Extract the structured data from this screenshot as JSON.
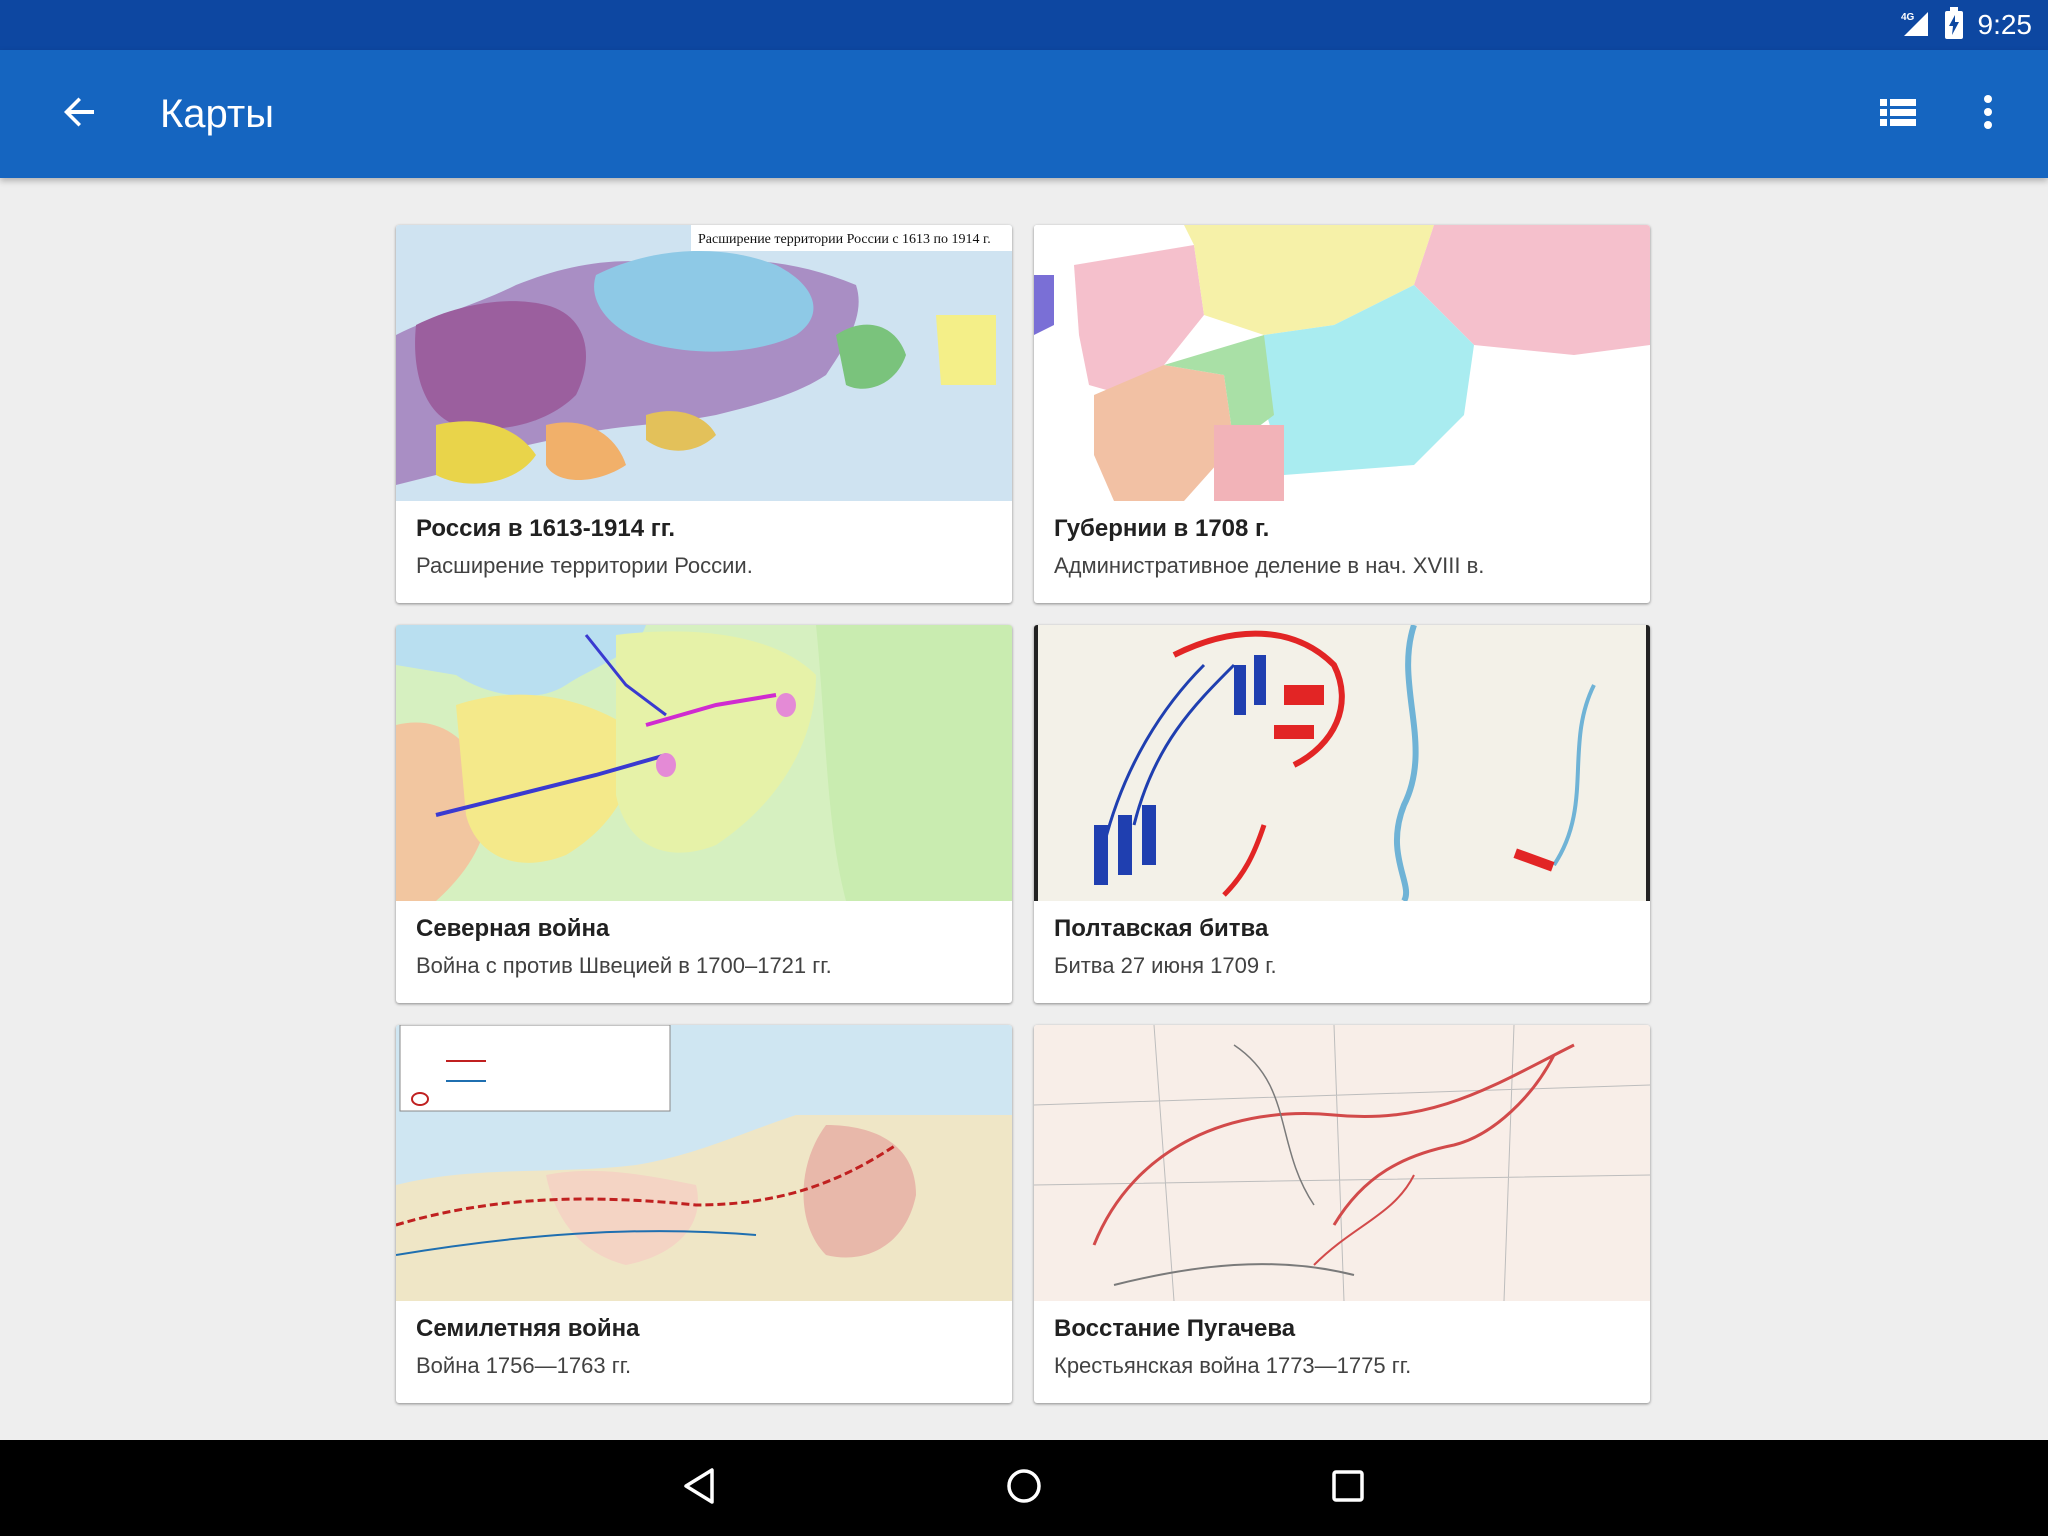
{
  "status_bar": {
    "network": "4G",
    "time": "9:25"
  },
  "app_bar": {
    "title": "Карты",
    "back_icon": "arrow-left-icon",
    "view_icon": "view-list-icon",
    "menu_icon": "more-vertical-icon"
  },
  "cards": [
    {
      "title": "Россия в 1613-1914 гг.",
      "subtitle": "Расширение территории России.",
      "map_caption": "Расширение территории России с 1613 по 1914 г."
    },
    {
      "title": "Губернии в 1708 г.",
      "subtitle": "Административное деление в нач. XVIII в.",
      "map_caption": ""
    },
    {
      "title": "Северная война",
      "subtitle": "Война с против Швецией в 1700–1721 гг.",
      "map_caption": ""
    },
    {
      "title": "Полтавская битва",
      "subtitle": "Битва 27 июня 1709 г.",
      "map_caption": ""
    },
    {
      "title": "Семилетняя война",
      "subtitle": "Война 1756—1763 гг.",
      "map_caption": ""
    },
    {
      "title": "Восстание Пугачева",
      "subtitle": "Крестьянская война 1773—1775 гг.",
      "map_caption": ""
    }
  ],
  "nav_bar": {
    "back_icon": "triangle-back-icon",
    "home_icon": "circle-home-icon",
    "recents_icon": "square-recents-icon"
  },
  "colors": {
    "status_bar": "#0d47a1",
    "app_bar": "#1565c0",
    "background": "#eeeeee"
  }
}
